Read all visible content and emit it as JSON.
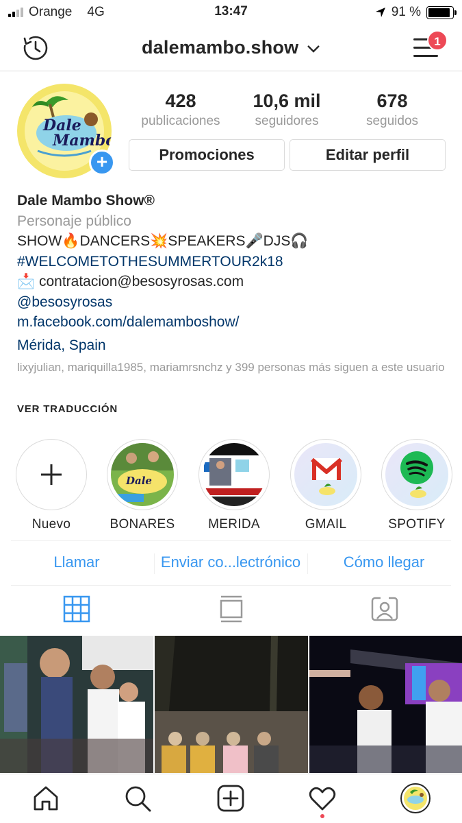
{
  "status_bar": {
    "carrier": "Orange",
    "network": "4G",
    "time": "13:47",
    "battery": "91 %",
    "battery_level": 0.91
  },
  "header": {
    "username": "dalemambo.show",
    "notification_badge": "1"
  },
  "profile": {
    "avatar_text_1": "Dale",
    "avatar_text_2": "Mambo",
    "stats": [
      {
        "number": "428",
        "label": "publicaciones"
      },
      {
        "number": "10,6 mil",
        "label": "seguidores"
      },
      {
        "number": "678",
        "label": "seguidos"
      }
    ],
    "buttons": {
      "promotions": "Promociones",
      "edit_profile": "Editar perfil"
    }
  },
  "bio": {
    "name": "Dale Mambo Show®",
    "category": "Personaje público",
    "line1": "SHOW🔥DANCERS💥SPEAKERS🎤DJS🎧",
    "hashtag": "#WELCOMETOTHESUMMERTOUR2k18",
    "email": "📩 contratacion@besosyrosas.com",
    "mention": "@besosyrosas",
    "website": "m.facebook.com/dalemamboshow/",
    "location": "Mérida, Spain",
    "followed_by": "lixyjulian, mariquilla1985, mariamrsnchz y 399 personas más siguen a este usuario",
    "translate": "VER TRADUCCIÓN"
  },
  "highlights": [
    {
      "label": "Nuevo"
    },
    {
      "label": "BONARES"
    },
    {
      "label": "MERIDA"
    },
    {
      "label": "GMAIL"
    },
    {
      "label": "SPOTIFY"
    }
  ],
  "actions": {
    "call": "Llamar",
    "email": "Enviar co...lectrónico",
    "directions": "Cómo llegar"
  },
  "colors": {
    "accent": "#3897f0",
    "link": "#003569",
    "badge": "#ed4956",
    "secondary_text": "#999999"
  }
}
